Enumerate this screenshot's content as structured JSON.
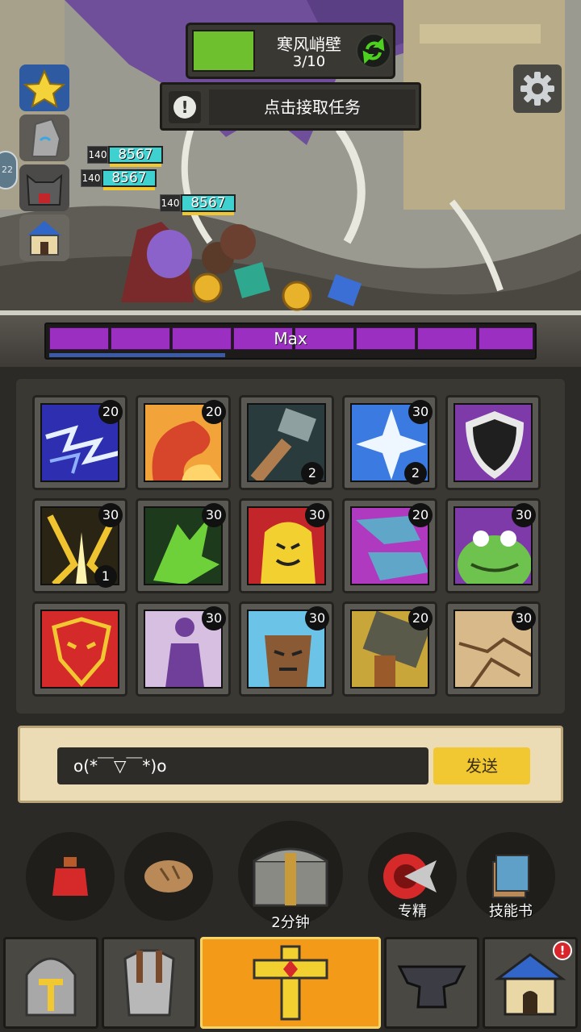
{
  "stage": {
    "name": "寒风峭壁",
    "progress": "3/10"
  },
  "task": {
    "label": "点击接取任务",
    "icon": "exclamation-icon"
  },
  "side_badge": "22",
  "hp_bars": [
    {
      "level": "140",
      "value": "8567"
    },
    {
      "level": "140",
      "value": "8567"
    },
    {
      "level": "140",
      "value": "8567"
    }
  ],
  "max_bar": {
    "label": "Max",
    "segments": 8
  },
  "skills": [
    {
      "name": "lightning-skill",
      "level": "20",
      "count": ""
    },
    {
      "name": "fire-wave-skill",
      "level": "20",
      "count": ""
    },
    {
      "name": "hammer-skill",
      "level": "",
      "count": "2"
    },
    {
      "name": "frost-cross-skill",
      "level": "30",
      "count": "2"
    },
    {
      "name": "shield-skill",
      "level": "",
      "count": ""
    },
    {
      "name": "sword-burst-skill",
      "level": "30",
      "count": "1"
    },
    {
      "name": "poison-claw-skill",
      "level": "30",
      "count": ""
    },
    {
      "name": "golem-skill",
      "level": "30",
      "count": ""
    },
    {
      "name": "wolf-pack-skill",
      "level": "20",
      "count": ""
    },
    {
      "name": "frog-skill",
      "level": "30",
      "count": ""
    },
    {
      "name": "rage-mask-skill",
      "level": "",
      "count": ""
    },
    {
      "name": "shadow-figure-skill",
      "level": "30",
      "count": ""
    },
    {
      "name": "minotaur-skill",
      "level": "30",
      "count": ""
    },
    {
      "name": "fist-skill",
      "level": "20",
      "count": ""
    },
    {
      "name": "earthquake-skill",
      "level": "30",
      "count": ""
    }
  ],
  "chat": {
    "message": "o(*￣▽￣*)o",
    "send_label": "发送"
  },
  "quick": {
    "potion_icon": "potion-icon",
    "bread_icon": "bread-icon",
    "chest_timer": "2分钟",
    "focus_label": "专精",
    "skillbook_label": "技能书"
  },
  "nav": {
    "items": [
      "helmet-icon",
      "armor-icon",
      "cross-relic-icon",
      "anvil-icon",
      "house-icon"
    ],
    "notification": "!"
  },
  "colors": {
    "accent": "#f39a18",
    "progress": "#6fc02e",
    "max_bar": "#9a2fc2",
    "send": "#f2c832"
  }
}
